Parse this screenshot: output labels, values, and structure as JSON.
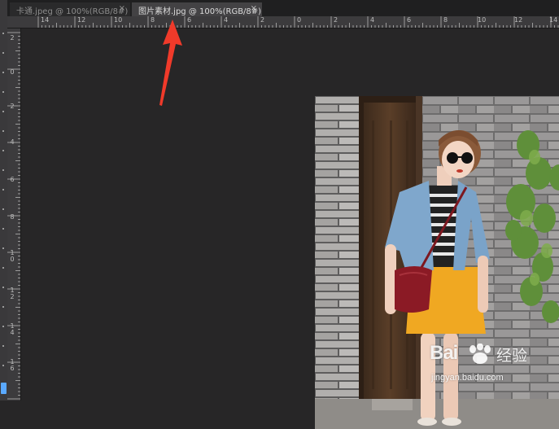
{
  "tabs": [
    {
      "label": "卡通.jpeg @ 100%(RGB/8#)",
      "close": "×",
      "active": false
    },
    {
      "label": "图片素材.jpg @ 100%(RGB/8#)",
      "close": "×",
      "active": true
    }
  ],
  "ruler_h_labels": [
    "14",
    "12",
    "10",
    "8",
    "6",
    "4",
    "2",
    "0",
    "2",
    "4",
    "6",
    "8",
    "10",
    "12",
    "14"
  ],
  "ruler_v_labels": [
    "2",
    "0",
    "2",
    "4",
    "6",
    "8",
    "10",
    "12",
    "14",
    "16"
  ],
  "watermark": {
    "brand": "Bai",
    "cn": "经验",
    "url": "jingyan.baidu.com"
  },
  "colors": {
    "canvas": "#272627",
    "ruler": "#3c3b3d",
    "active_tab": "#434244",
    "arrow": "#f03a2a"
  },
  "icons": [
    "close-icon",
    "paw-icon",
    "annotation-arrow"
  ]
}
